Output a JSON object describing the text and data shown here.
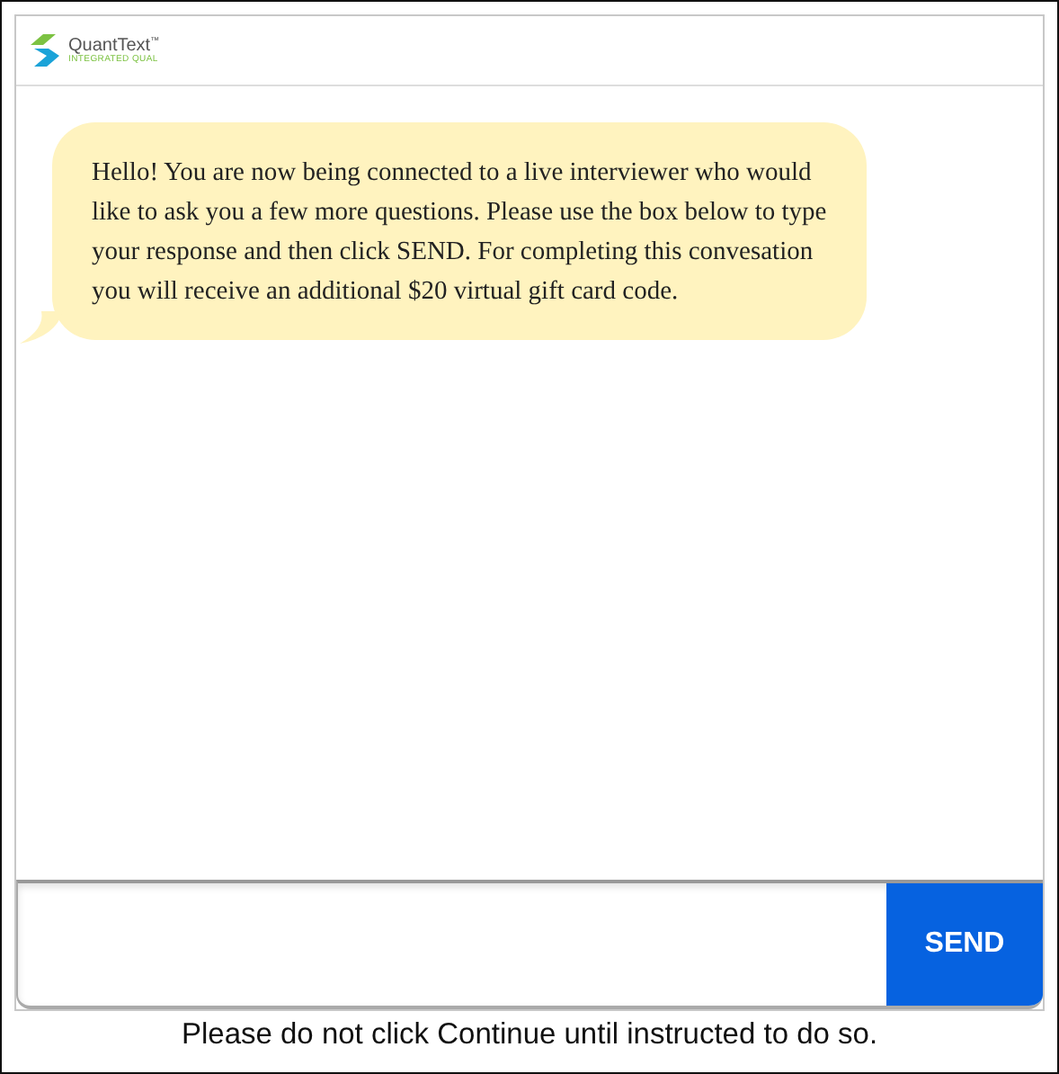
{
  "header": {
    "brand": "QuantText",
    "trademark": "™",
    "tagline": "INTEGRATED QUAL"
  },
  "messages": [
    {
      "kind": "incoming",
      "text": "Hello! You are now being connected to a live interviewer who would like to ask you a few more questions. Please use the box below to type your response and then click SEND. For completing this convesation you will receive an additional $20 virtual gift card code."
    }
  ],
  "composer": {
    "button": "SEND"
  },
  "footer": "Please do not click Continue until instructed to do so."
}
